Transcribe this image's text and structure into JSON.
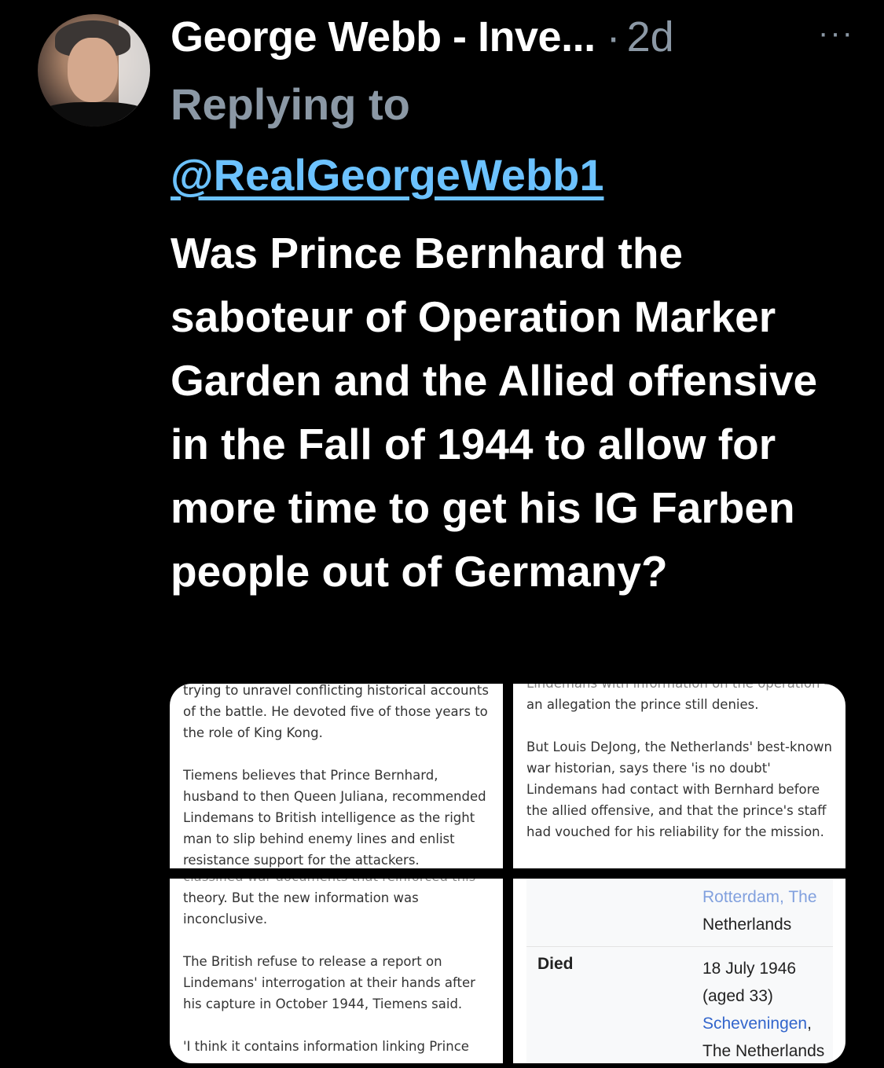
{
  "tweet": {
    "author_name": "George Webb - Inve...",
    "separator": "·",
    "age": "2d",
    "more_label": "···",
    "replying_label": "Replying to",
    "reply_handle": "@RealGeorgeWebb1",
    "text": "Was Prince Bernhard the saboteur of Operation Marker Garden and the Allied offensive in the Fall of 1944 to allow for more time to get his IG Farben people out of Germany?"
  },
  "media": {
    "tile1": {
      "p1": "trying to unravel conflicting historical accounts of the battle. He devoted five of those years to the role of King Kong.",
      "p2": "Tiemens believes that Prince Bernhard, husband to then Queen Juliana, recommended Lindemans to British intelligence as the right man to slip behind enemy lines and enlist resistance support for the attackers."
    },
    "tile2": {
      "p0": "Lindemans with information on the operation --",
      "p1": "an allegation the prince still denies.",
      "p2": "But Louis DeJong, the Netherlands' best-known war historian, says there 'is no doubt' Lindemans had contact with Bernhard before the allied offensive, and that the prince's staff had vouched for his reliability for the mission."
    },
    "tile3": {
      "p0": "classified war documents that reinforced this",
      "p1": "theory. But the new information was inconclusive.",
      "p2": "The British refuse to release a report on Lindemans' interrogation at their hands after his capture in October 1944, Tiemens said.",
      "p3": "'I think it contains information linking Prince"
    },
    "tile4": {
      "cut_top": "Rotterdam, The",
      "place1": "Netherlands",
      "died_label": "Died",
      "died_date": "18 July 1946",
      "died_age": "(aged 33)",
      "died_place_link": "Scheveningen",
      "died_place_comma": ",",
      "died_country": "The Netherlands"
    }
  }
}
